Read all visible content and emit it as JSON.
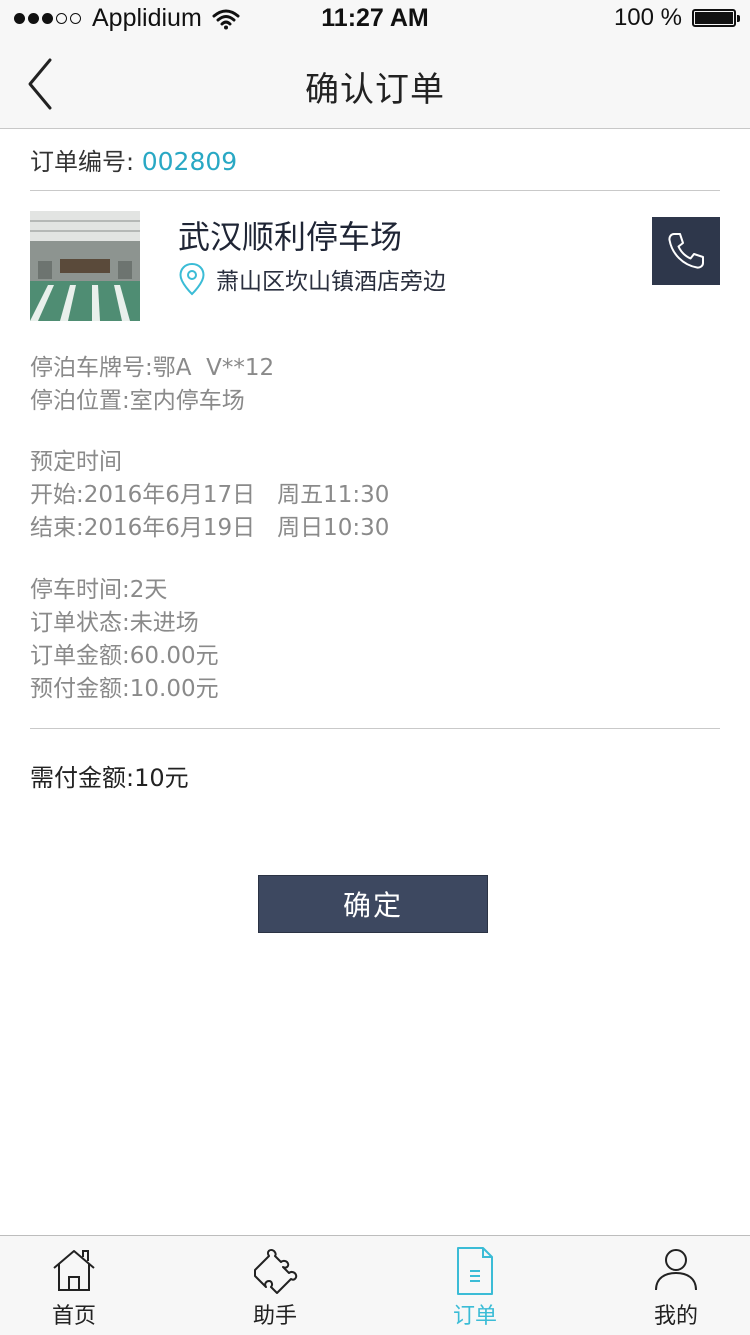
{
  "status_bar": {
    "carrier": "Applidium",
    "time": "11:27 AM",
    "battery": "100 %",
    "battery_level": 1.0
  },
  "nav": {
    "title": "确认订单",
    "back_icon": "chevron-left-icon"
  },
  "order": {
    "number_label": "订单编号:",
    "number_value": "002809"
  },
  "lot": {
    "name": "武汉顺利停车场",
    "address": "萧山区坎山镇酒店旁边",
    "pin_icon": "location-pin-icon",
    "call_icon": "phone-icon"
  },
  "details": {
    "plate": "停泊车牌号:鄂A  V**12",
    "position": "停泊位置:室内停车场",
    "reserve_title": "预定时间",
    "start": "开始:2016年6月17日   周五11:30",
    "end": "结束:2016年6月19日   周日10:30",
    "duration": "停车时间:2天",
    "status": "订单状态:未进场",
    "amount": "订单金额:60.00元",
    "prepaid": "预付金额:10.00元"
  },
  "payment": {
    "due": "需付金额:10元"
  },
  "confirm_label": "确定",
  "tabs": [
    {
      "label": "首页",
      "icon": "home-icon",
      "active": false
    },
    {
      "label": "助手",
      "icon": "puzzle-icon",
      "active": false
    },
    {
      "label": "订单",
      "icon": "document-icon",
      "active": true
    },
    {
      "label": "我的",
      "icon": "user-icon",
      "active": false
    }
  ],
  "colors": {
    "accent": "#3bbcd6",
    "order_number": "#29a8c4",
    "button": "#3d4860",
    "call_button": "#2e374b"
  }
}
